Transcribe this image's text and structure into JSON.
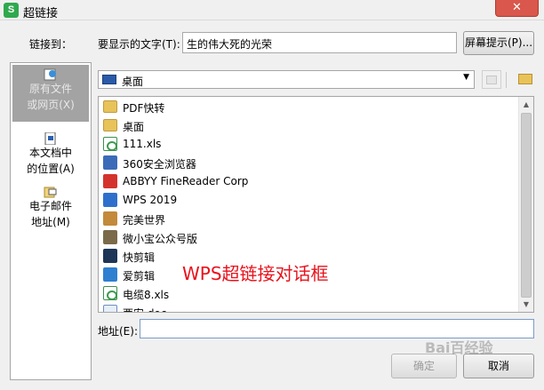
{
  "window": {
    "title": "超链接",
    "app_icon_letter": "S",
    "close": "✕"
  },
  "link_to_label": "链接到：",
  "display_text": {
    "label": "要显示的文字(T):",
    "value": "生的伟大死的光荣"
  },
  "screentip_button": "屏幕提示(P)...",
  "sidebar": {
    "items": [
      {
        "label1": "原有文件",
        "label2": "或网页(X)",
        "active": true
      },
      {
        "label1": "本文档中",
        "label2": "的位置(A)",
        "active": false
      },
      {
        "label1": "电子邮件",
        "label2": "地址(M)",
        "active": false
      }
    ]
  },
  "folder_combo": {
    "value": "桌面"
  },
  "files": [
    {
      "name": "PDF快转",
      "icon": "folder"
    },
    {
      "name": "桌面",
      "icon": "folder"
    },
    {
      "name": "111.xls",
      "icon": "xls"
    },
    {
      "name": "360安全浏览器",
      "icon": "shortcut"
    },
    {
      "name": "ABBYY FineReader Corp",
      "icon": "abbyy"
    },
    {
      "name": "WPS 2019",
      "icon": "wps"
    },
    {
      "name": "完美世界",
      "icon": "game"
    },
    {
      "name": "微小宝公众号版",
      "icon": "mini"
    },
    {
      "name": "快剪辑",
      "icon": "kuai"
    },
    {
      "name": "爱剪辑",
      "icon": "aijian"
    },
    {
      "name": "电缆8.xls",
      "icon": "xls"
    },
    {
      "name": "西安.doc",
      "icon": "doc"
    }
  ],
  "annotation": "WPS超链接对话框",
  "address": {
    "label": "地址(E):",
    "value": ""
  },
  "buttons": {
    "ok": "确定",
    "cancel": "取消"
  },
  "watermark": "Bai百经验"
}
